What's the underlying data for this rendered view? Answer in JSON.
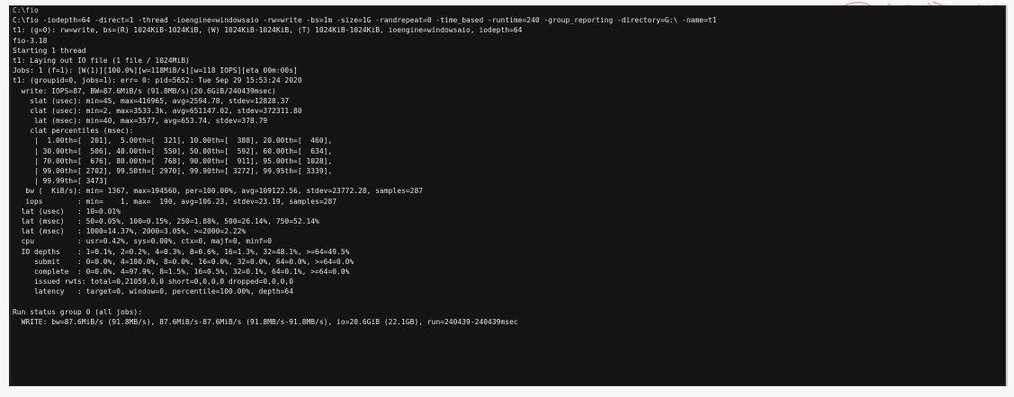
{
  "terminal": {
    "lines": [
      "C:\\fio",
      "C:\\fio -iodepth=64 -direct=1 -thread -ioengine=windowsaio -rw=write -bs=1m -size=1G -randrepeat=0 -time_based -runtime=240 -group_reporting -directory=G:\\ -name=t1",
      "t1: (g=0): rw=write, bs=(R) 1024KiB-1024KiB, (W) 1024KiB-1024KiB, (T) 1024KiB-1024KiB, ioengine=windowsaio, iodepth=64",
      "fio-3.18",
      "Starting 1 thread",
      "t1: Laying out IO file (1 file / 1024MiB)",
      "Jobs: 1 (f=1): [W(1)][100.0%][w=118MiB/s][w=118 IOPS][eta 00m:00s]",
      "t1: (groupid=0, jobs=1): err= 0: pid=5652: Tue Sep 29 15:53:24 2020",
      "  write: IOPS=87, BW=87.6MiB/s (91.8MB/s)(20.6GiB/240439msec)",
      "    slat (usec): min=45, max=416965, avg=2594.78, stdev=12828.37",
      "    clat (usec): min=2, max=3533.3k, avg=651147.02, stdev=372311.80",
      "     lat (msec): min=40, max=3577, avg=653.74, stdev=378.79",
      "    clat percentiles (msec):",
      "     |  1.00th=[  201],  5.00th=[  321], 10.00th=[  388], 20.00th=[  460],",
      "     | 30.00th=[  506], 40.00th=[  550], 50.00th=[  592], 60.00th=[  634],",
      "     | 70.00th=[  676], 80.00th=[  768], 90.00th=[  911], 95.00th=[ 1028],",
      "     | 99.00th=[ 2702], 99.50th=[ 2970], 99.90th=[ 3272], 99.95th=[ 3339],",
      "     | 99.99th=[ 3473]",
      "   bw (  KiB/s): min= 1367, max=194560, per=100.00%, avg=109122.56, stdev=23772.28, samples=287",
      "   iops        : min=    1, max=  190, avg=106.23, stdev=23.19, samples=287",
      "  lat (usec)   : 10=0.01%",
      "  lat (msec)   : 50=0.05%, 100=0.15%, 250=1.88%, 500=26.14%, 750=52.14%",
      "  lat (msec)   : 1000=14.37%, 2000=3.05%, >=2000=2.22%",
      "  cpu          : usr=0.42%, sys=0.00%, ctx=0, majf=0, minf=0",
      "  IO depths    : 1=0.1%, 2=0.2%, 4=0.3%, 8=0.6%, 16=1.3%, 32=48.1%, >=64=49.5%",
      "     submit    : 0=0.0%, 4=100.0%, 8=0.0%, 16=0.0%, 32=0.0%, 64=0.0%, >=64=0.0%",
      "     complete  : 0=0.0%, 4=97.9%, 8=1.5%, 16=0.5%, 32=0.1%, 64=0.1%, >=64=0.0%",
      "     issued rwts: total=0,21059,0,0 short=0,0,0,0 dropped=0,0,0,0",
      "     latency   : target=0, window=0, percentile=100.00%, depth=64",
      "",
      "Run status group 0 (all jobs):",
      "  WRITE: bw=87.6MiB/s (91.8MB/s), 87.6MiB/s-87.6MiB/s (91.8MB/s-91.8MB/s), io=20.6GiB (22.1GB), run=240439-240439msec"
    ]
  },
  "colors": {
    "console_background": "#141414",
    "console_text": "#e4e4e4",
    "page_background": "#f7f7f7",
    "scan_mark": "#d46a6a"
  }
}
